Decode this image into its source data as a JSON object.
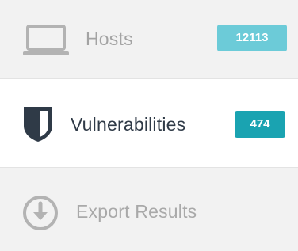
{
  "sidebar": {
    "items": [
      {
        "label": "Hosts",
        "count": "12113",
        "icon": "laptop-icon"
      },
      {
        "label": "Vulnerabilities",
        "count": "474",
        "icon": "shield-icon"
      },
      {
        "label": "Export Results",
        "icon": "download-circle-icon"
      }
    ]
  },
  "colors": {
    "hosts_badge": "#6ccbd8",
    "vulns_badge": "#1aa3b1",
    "shield": "#2f3a47",
    "muted_icon": "#b3b3b3"
  }
}
